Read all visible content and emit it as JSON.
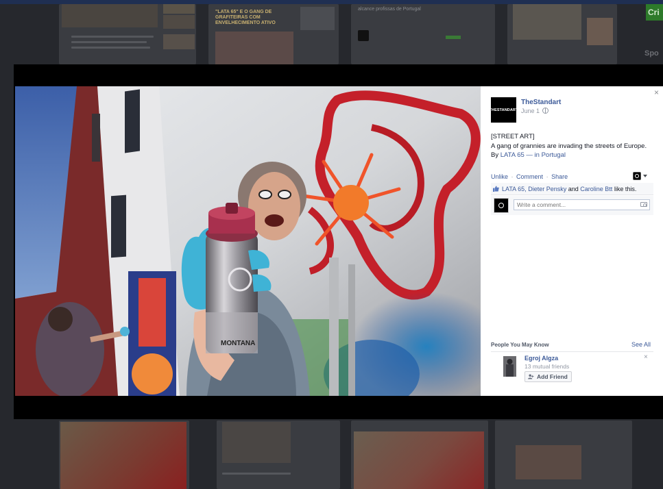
{
  "background_page": {
    "headline": "\"LATA 65\" E O GANG DE GRAFITEIRAS COM ENVELHECIMENTO ATIVO",
    "subhead": "alcance profissas de Portugal",
    "side_button": "Cri",
    "side_text": "Spo"
  },
  "post": {
    "page_name": "TheStandart",
    "page_avatar_text": "THESTANDART",
    "date": "June 1",
    "text_line1": "[STREET ART]",
    "text_line2": "A gang of grannies are invading the streets of Europe.",
    "by_prefix": "By",
    "tagged": "LATA 65",
    "dash_in": "— in",
    "location": "Portugal",
    "actions": {
      "unlike": "Unlike",
      "comment": "Comment",
      "share": "Share",
      "separator": "·"
    },
    "likes": {
      "names": "LATA 65, Dieter Pensky",
      "and": "and",
      "last_name": "Caroline Btt",
      "suffix": "like this."
    },
    "comment_placeholder": "Write a comment..."
  },
  "pymk": {
    "title": "People You May Know",
    "see_all": "See All",
    "person": {
      "name": "Egroj Algza",
      "mutual": "13 mutual friends",
      "button": "Add Friend"
    },
    "close": "×"
  },
  "lightbox": {
    "close": "×"
  },
  "photo": {
    "can_brand": "MONTANA"
  },
  "colors": {
    "fb_link": "#3b5998",
    "backdrop": "#000000",
    "panel_bg": "#ffffff",
    "meta_gray": "#9197a3"
  }
}
